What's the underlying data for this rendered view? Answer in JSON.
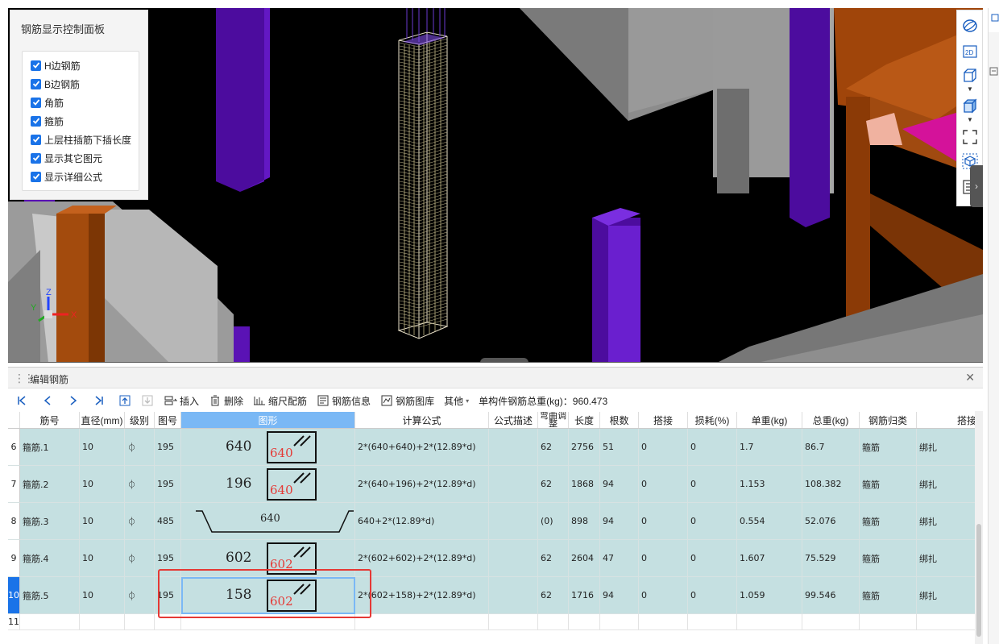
{
  "control_panel": {
    "title": "钢筋显示控制面板",
    "options": [
      {
        "label": "H边钢筋",
        "checked": true
      },
      {
        "label": "B边钢筋",
        "checked": true
      },
      {
        "label": "角筋",
        "checked": true
      },
      {
        "label": "箍筋",
        "checked": true
      },
      {
        "label": "上层柱插筋下插长度",
        "checked": true
      },
      {
        "label": "显示其它图元",
        "checked": true
      },
      {
        "label": "显示详细公式",
        "checked": true
      }
    ]
  },
  "viewport": {
    "axis_labels": {
      "x": "X",
      "y": "Y",
      "z": "Z"
    },
    "view_tools": [
      "orbit-icon",
      "2d-view-icon",
      "3d-box-icon",
      "3d-solid-icon",
      "fit-view-icon",
      "view-cube-icon",
      "list-icon"
    ],
    "view_tool_2d_label": "2D"
  },
  "edit_panel": {
    "title": "编辑钢筋",
    "toolbar": {
      "insert": "插入",
      "delete": "删除",
      "scale_rebar": "缩尺配筋",
      "rebar_info": "钢筋信息",
      "rebar_library": "钢筋图库",
      "other": "其他",
      "total_weight_label": "单构件钢筋总重(kg)：960.473"
    },
    "columns": [
      "筋号",
      "直径(mm)",
      "级别",
      "图号",
      "图形",
      "计算公式",
      "公式描述",
      "弯曲调整",
      "长度",
      "根数",
      "搭接",
      "损耗(%)",
      "单重(kg)",
      "总重(kg)",
      "钢筋归类",
      "搭接"
    ],
    "rows": [
      {
        "row_no": "6",
        "name": "箍筋.1",
        "diameter": "10",
        "grade": "⏀",
        "fig_no": "195",
        "shape_num": "640",
        "shape_box": "640",
        "shape_type": "box",
        "formula": "2*(640+640)+2*(12.89*d)",
        "desc": "",
        "bend": "62",
        "length": "2756",
        "count": "51",
        "lap": "0",
        "loss": "0",
        "unit_w": "1.7",
        "total_w": "86.7",
        "category": "箍筋",
        "lap_type": "绑扎"
      },
      {
        "row_no": "7",
        "name": "箍筋.2",
        "diameter": "10",
        "grade": "⏀",
        "fig_no": "195",
        "shape_num": "196",
        "shape_box": "640",
        "shape_type": "box",
        "formula": "2*(640+196)+2*(12.89*d)",
        "desc": "",
        "bend": "62",
        "length": "1868",
        "count": "94",
        "lap": "0",
        "loss": "0",
        "unit_w": "1.153",
        "total_w": "108.382",
        "category": "箍筋",
        "lap_type": "绑扎"
      },
      {
        "row_no": "8",
        "name": "箍筋.3",
        "diameter": "10",
        "grade": "⏀",
        "fig_no": "485",
        "shape_num": "640",
        "shape_box": "",
        "shape_type": "hook",
        "formula": "640+2*(12.89*d)",
        "desc": "",
        "bend": "(0)",
        "length": "898",
        "count": "94",
        "lap": "0",
        "loss": "0",
        "unit_w": "0.554",
        "total_w": "52.076",
        "category": "箍筋",
        "lap_type": "绑扎"
      },
      {
        "row_no": "9",
        "name": "箍筋.4",
        "diameter": "10",
        "grade": "⏀",
        "fig_no": "195",
        "shape_num": "602",
        "shape_box": "602",
        "shape_type": "box",
        "formula": "2*(602+602)+2*(12.89*d)",
        "desc": "",
        "bend": "62",
        "length": "2604",
        "count": "47",
        "lap": "0",
        "loss": "0",
        "unit_w": "1.607",
        "total_w": "75.529",
        "category": "箍筋",
        "lap_type": "绑扎"
      },
      {
        "row_no": "10",
        "name": "箍筋.5",
        "diameter": "10",
        "grade": "⏀",
        "fig_no": "195",
        "shape_num": "158",
        "shape_box": "602",
        "shape_type": "box",
        "formula": "2*(602+158)+2*(12.89*d)",
        "desc": "",
        "bend": "62",
        "length": "1716",
        "count": "94",
        "lap": "0",
        "loss": "0",
        "unit_w": "1.059",
        "total_w": "99.546",
        "category": "箍筋",
        "lap_type": "绑扎"
      }
    ],
    "empty_row_no": "11"
  },
  "colors": {
    "accent": "#1a73e8",
    "row_bg": "#c5e0e1",
    "header_highlight": "#7ab8f5",
    "highlight_border": "#e53935",
    "purple_column": "#5a12b5"
  }
}
